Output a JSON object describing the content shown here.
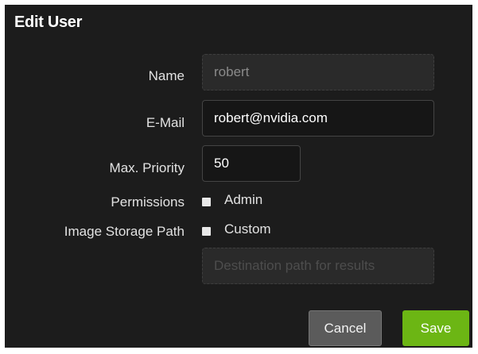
{
  "dialog": {
    "title": "Edit User",
    "name": {
      "label": "Name",
      "value": "robert"
    },
    "email": {
      "label": "E-Mail",
      "value": "robert@nvidia.com"
    },
    "priority": {
      "label": "Max. Priority",
      "value": "50"
    },
    "permissions": {
      "label": "Permissions",
      "option_label": "Admin",
      "checked": false
    },
    "storage": {
      "label": "Image Storage Path",
      "option_label": "Custom",
      "checked": false,
      "placeholder": "Destination path for results"
    },
    "buttons": {
      "cancel": "Cancel",
      "save": "Save"
    },
    "colors": {
      "background": "#1c1c1c",
      "save": "#6cb614",
      "cancel": "#5b5b5b"
    }
  }
}
